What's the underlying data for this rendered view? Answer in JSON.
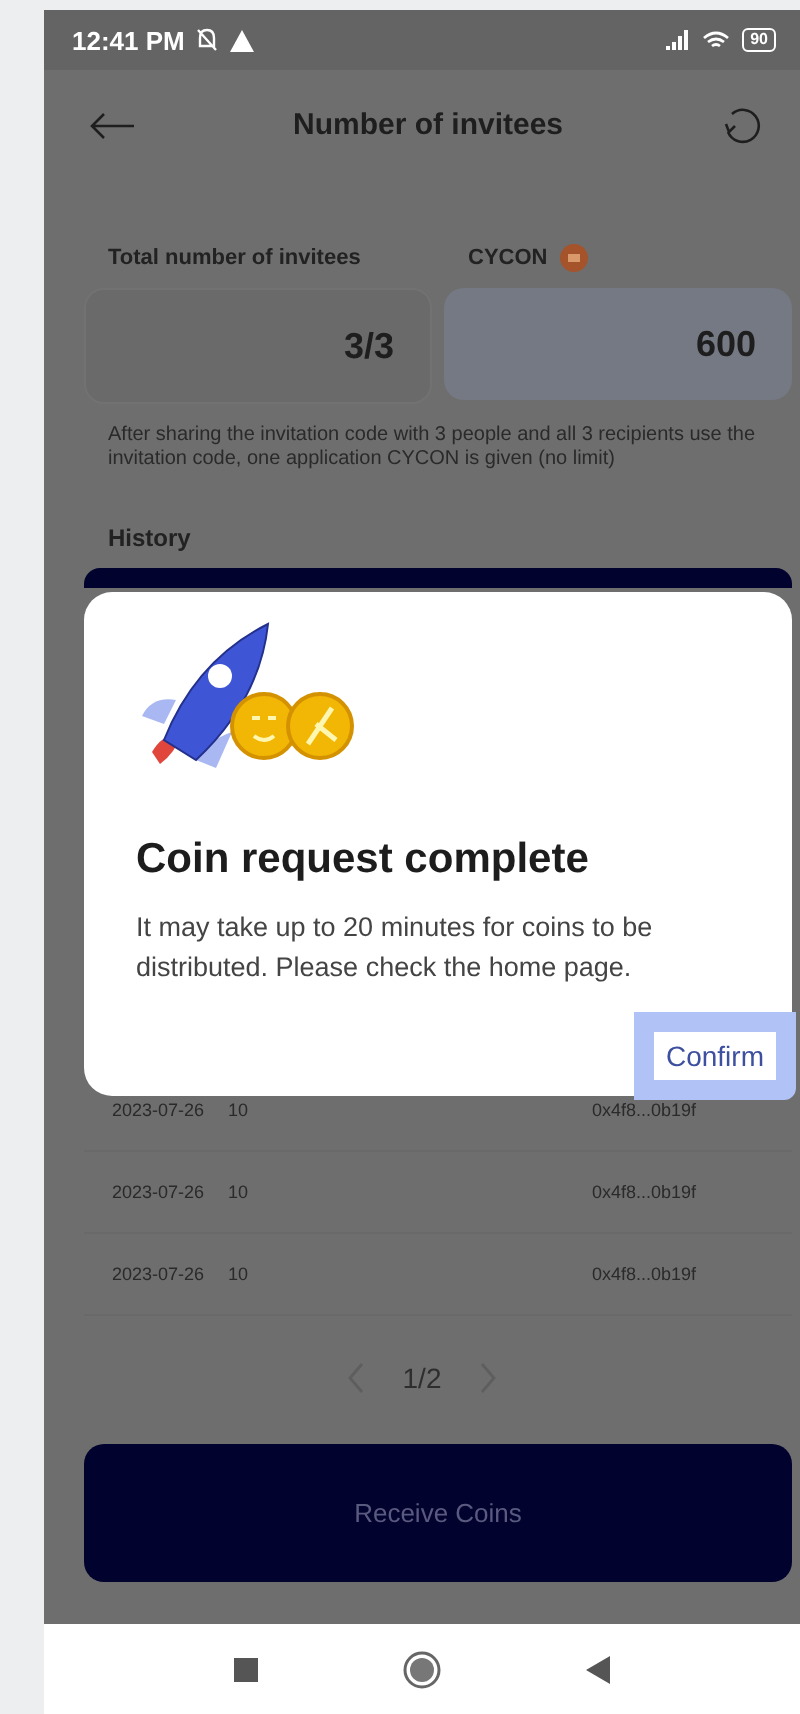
{
  "status_bar": {
    "time": "12:41 PM",
    "battery": "90"
  },
  "header": {
    "title": "Number of invitees"
  },
  "stats": [
    {
      "label": "Total number of invitees",
      "value": "3/3",
      "kind": "plain"
    },
    {
      "label": "CYCON",
      "value": "600",
      "kind": "coin"
    }
  ],
  "note": "After sharing the invitation code with 3 people and all 3 recipients use the invitation code, one application CYCON is given (no limit)",
  "history": {
    "title": "History",
    "rows": [
      {
        "date": "2023-07-26",
        "amount": "10",
        "address": "0x4f8...0b19f"
      },
      {
        "date": "2023-07-26",
        "amount": "10",
        "address": "0x4f8...0b19f"
      },
      {
        "date": "2023-07-26",
        "amount": "10",
        "address": "0x4f8...0b19f"
      }
    ]
  },
  "pagination": {
    "page": "1/2"
  },
  "receive_button": {
    "label": "Receive Coins"
  },
  "dialog": {
    "title": "Coin request complete",
    "message": "It may take up to 20 minutes for coins to be distributed. Please check the home page.",
    "confirm": "Confirm"
  }
}
